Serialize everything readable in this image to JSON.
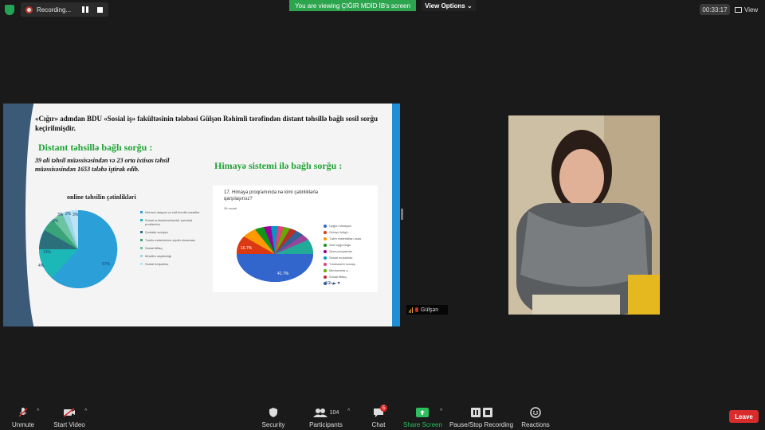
{
  "topbar": {
    "recording_label": "Recording...",
    "viewing_banner": "You are viewing ÇIĞIR MDİD İB's screen",
    "view_options_label": "View Options ⌄",
    "timer": "00:33:17",
    "view_label": "View"
  },
  "slide": {
    "heading": "«Cığır» adından BDU «Sosial iş» fakültəsinin tələbəsi Gülşən Rəhimli tərəfindən distant təhsillə bağlı sosil sorğu keçirilmişdir.",
    "survey1_title": "Distant təhsillə bağlı sorğu :",
    "survey1_note": "39 ali təhsil müəssisəsindən və 23 orta ixtisas təhsil müəssisəsindən 1653 tələbə iştirak edib.",
    "survey2_title": "Himayə sistemi ilə bağlı sorğu :",
    "pie1_title": "online təhsilin çətinlikləri",
    "pie1_labels": [
      "57%",
      "13%",
      "4%",
      "9%",
      "3%",
      "2%",
      "3%"
    ],
    "pie1_legend": [
      "İnternet əlaqəsi və zəif texniki vəsaitlər",
      "Sosial ərəfəsində/maddi, psixoloji problemlər",
      "Çoxtaliy səviyyə",
      "Tədris materialının əlçatlı olmaması",
      "Sosial ittifaq",
      "Müəllim əlçatanlığı",
      "Sosial müşahidə"
    ],
    "poll": {
      "question": "17. Himayə proqramında nə kimi çətinliklərlə qarşılaşırsız?",
      "responses": "36 cavab",
      "slice_labels": [
        "41.7%",
        "16.7%"
      ],
      "legend": [
        "Uyğun olmayan",
        "Onlayn bölgü...",
        "Təlim materialları əsas",
        "Vaxt uyğunluğu",
        "Qısa proqramlar",
        "Sosial müşahidə",
        "Tələbələrin maraq...",
        "Mentorlarla ə...",
        "Sosial ittifaq",
        "Digər"
      ],
      "page": "1/2"
    }
  },
  "participant": {
    "name": "Gülşən"
  },
  "toolbar": {
    "unmute": "Unmute",
    "start_video": "Start Video",
    "security": "Security",
    "participants": "Participants",
    "participants_count": "104",
    "chat": "Chat",
    "chat_badge": "5",
    "share_screen": "Share Screen",
    "pause_stop": "Pause/Stop Recording",
    "reactions": "Reactions",
    "leave": "Leave"
  },
  "colors": {
    "viewing_banner": "#2da44e",
    "leave_button": "#d92b2b",
    "slide_accent": "#1e8fd6",
    "slide_band": "#3a5a78",
    "slide_green_heading": "#21a336",
    "share_screen": "#2dbe60"
  }
}
